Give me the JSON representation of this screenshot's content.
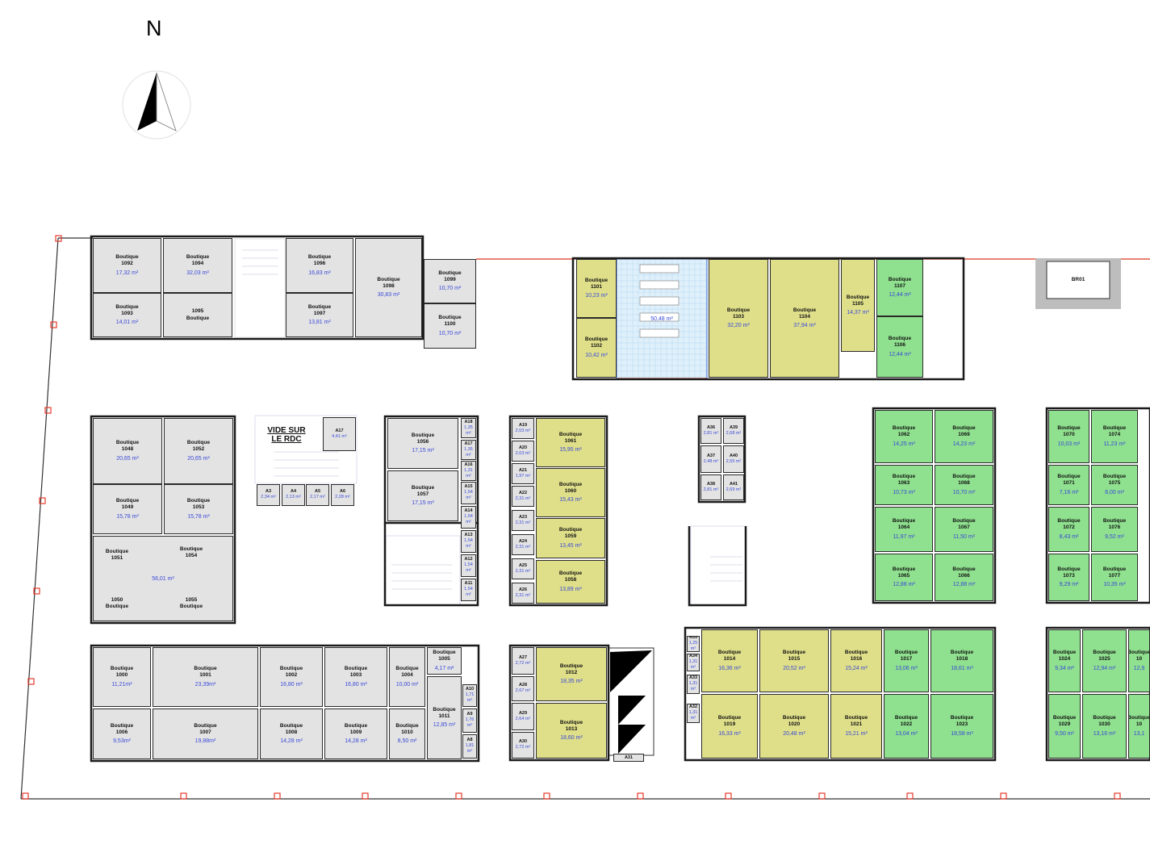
{
  "compass": {
    "label": "N",
    "icon": "north-arrow-icon"
  },
  "colors": {
    "neutral": "#e3e3e3",
    "yellow": "#dfdf8a",
    "green": "#8fe08f",
    "area_text": "#3a4ad8",
    "facade_line": "#d9381e",
    "marker": "#e53a2c"
  },
  "void": {
    "label_line1": "VIDE SUR",
    "label_line2": "LE RDC"
  },
  "north_block": {
    "b1092": {
      "name": "Boutique\n1092",
      "area": "17,32 m²"
    },
    "b1094": {
      "name": "Boutique\n1094",
      "area": "32,03 m²"
    },
    "b1093": {
      "name": "Boutique\n1093",
      "area": "14,01 m²"
    },
    "b1095": {
      "name": "1095\nBoutique",
      "area": ""
    },
    "b1096": {
      "name": "Boutique\n1096",
      "area": "16,83 m²"
    },
    "b1097": {
      "name": "Boutique\n1097",
      "area": "13,81 m²"
    },
    "b1098": {
      "name": "Boutique\n1098",
      "area": "30,83 m²"
    },
    "b1099": {
      "name": "Boutique\n1099",
      "area": "10,70 m²"
    },
    "b1100": {
      "name": "Boutique\n1100",
      "area": "10,70 m²"
    },
    "b1101": {
      "name": "Boutique\n1101",
      "area": "10,23 m²"
    },
    "b1102": {
      "name": "Boutique\n1102",
      "area": "10,42 m²"
    },
    "sanitary": {
      "name": "",
      "area": "50,48 m²"
    },
    "b1103": {
      "name": "Boutique\n1103",
      "area": "32,20 m²"
    },
    "b1104": {
      "name": "Boutique\n1104",
      "area": "37,94 m²"
    },
    "b1105": {
      "name": "Boutique\n1105",
      "area": "14,37 m²"
    },
    "b1107": {
      "name": "Boutique\n1107",
      "area": "12,44 m²"
    },
    "b1106": {
      "name": "Boutique\n1106",
      "area": "12,44 m²"
    },
    "br01": {
      "name": "BR01",
      "area": ""
    }
  },
  "middle_block": {
    "b1048": {
      "name": "Boutique\n1048",
      "area": "20,65 m²"
    },
    "b1052": {
      "name": "Boutique\n1052",
      "area": "20,65 m²"
    },
    "b1049": {
      "name": "Boutique\n1049",
      "area": "15,78 m²"
    },
    "b1053": {
      "name": "Boutique\n1053",
      "area": "15,78 m²"
    },
    "b1051": {
      "name": "Boutique\n1051"
    },
    "b1054": {
      "name": "Boutique\n1054"
    },
    "b1050": {
      "name": "1050\nBoutique"
    },
    "b1055": {
      "name": "1055\nBoutique"
    },
    "hall_area": "56,01 m²",
    "a17_top": {
      "name": "A17",
      "area": "4,41 m²"
    },
    "a3": {
      "name": "A3",
      "area": "2,34 m²"
    },
    "a4": {
      "name": "A4",
      "area": "2,13 m²"
    },
    "a5": {
      "name": "A5",
      "area": "2,17 m²"
    },
    "a6": {
      "name": "A6",
      "area": "2,28 m²"
    },
    "b1056": {
      "name": "Boutique\n1056",
      "area": "17,15 m²"
    },
    "b1057": {
      "name": "Boutique\n1057",
      "area": "17,15 m²"
    },
    "a18": {
      "name": "A18",
      "area": "1,35 m²"
    },
    "a17": {
      "name": "A17",
      "area": "1,35 m²"
    },
    "a16": {
      "name": "A16",
      "area": "1,31 m²"
    },
    "a15": {
      "name": "A15",
      "area": "1,54 m²"
    },
    "a14": {
      "name": "A14",
      "area": "1,54 m²"
    },
    "a13": {
      "name": "A13",
      "area": "1,54 m²"
    },
    "a12": {
      "name": "A12",
      "area": "1,54 m²"
    },
    "a11": {
      "name": "A11",
      "area": "1,54 m²"
    },
    "a19": {
      "name": "A19",
      "area": "2,03 m²"
    },
    "a20": {
      "name": "A20",
      "area": "2,03 m²"
    },
    "a21": {
      "name": "A21",
      "area": "1,97 m²"
    },
    "a22": {
      "name": "A22",
      "area": "2,31 m²"
    },
    "a23": {
      "name": "A23",
      "area": "2,31 m²"
    },
    "a24": {
      "name": "A24",
      "area": "2,31 m²"
    },
    "a25": {
      "name": "A25",
      "area": "2,31 m²"
    },
    "a26": {
      "name": "A26",
      "area": "2,31 m²"
    },
    "b1061": {
      "name": "Boutique\n1061",
      "area": "15,95 m²"
    },
    "b1060": {
      "name": "Boutique\n1060",
      "area": "15,43 m²"
    },
    "b1059": {
      "name": "Boutique\n1059",
      "area": "13,45 m²"
    },
    "b1058": {
      "name": "Boutique\n1058",
      "area": "13,89 m²"
    },
    "a36": {
      "name": "A36",
      "area": "2,81 m²"
    },
    "a39": {
      "name": "A39",
      "area": "2,68 m²"
    },
    "a37": {
      "name": "A37",
      "area": "2,48 m²"
    },
    "a40": {
      "name": "A40",
      "area": "2,55 m²"
    },
    "a38": {
      "name": "A38",
      "area": "2,81 m²"
    },
    "a41": {
      "name": "A41",
      "area": "2,69 m²"
    },
    "b1062": {
      "name": "Boutique\n1062",
      "area": "14,25 m²"
    },
    "b1069": {
      "name": "Boutique\n1069",
      "area": "14,23 m²"
    },
    "b1063": {
      "name": "Boutique\n1063",
      "area": "10,73 m²"
    },
    "b1068": {
      "name": "Boutique\n1068",
      "area": "10,70 m²"
    },
    "b1064": {
      "name": "Boutique\n1064",
      "area": "11,97 m²"
    },
    "b1067": {
      "name": "Boutique\n1067",
      "area": "11,50 m²"
    },
    "b1065": {
      "name": "Boutique\n1065",
      "area": "12,88 m²"
    },
    "b1066": {
      "name": "Boutique\n1066",
      "area": "12,88 m²"
    },
    "b1070": {
      "name": "Boutique\n1070",
      "area": "10,03 m²"
    },
    "b1074": {
      "name": "Boutique\n1074",
      "area": "11,23 m²"
    },
    "b1071": {
      "name": "Boutique\n1071",
      "area": "7,16 m²"
    },
    "b1075": {
      "name": "Boutique\n1075",
      "area": "8,00 m²"
    },
    "b1072": {
      "name": "Boutique\n1072",
      "area": "8,43 m²"
    },
    "b1076": {
      "name": "Boutique\n1076",
      "area": "9,52 m²"
    },
    "b1073": {
      "name": "Boutique\n1073",
      "area": "9,29 m²"
    },
    "b1077": {
      "name": "Boutique\n1077",
      "area": "10,35 m²"
    }
  },
  "south_block": {
    "b1000": {
      "name": "Boutique\n1000",
      "area": "11,21m²"
    },
    "b1001": {
      "name": "Boutique\n1001",
      "area": "23,39m²"
    },
    "b1002": {
      "name": "Boutique\n1002",
      "area": "16,80 m²"
    },
    "b1003": {
      "name": "Boutique\n1003",
      "area": "16,80 m²"
    },
    "b1004": {
      "name": "Boutique\n1004",
      "area": "10,00 m²"
    },
    "b1005": {
      "name": "Boutique\n1005",
      "area": "4,17 m²"
    },
    "b1011": {
      "name": "Boutique\n1011",
      "area": "12,85 m²"
    },
    "b1006": {
      "name": "Boutique\n1006",
      "area": "9,53m²"
    },
    "b1007": {
      "name": "Boutique\n1007",
      "area": "19,88m²"
    },
    "b1008": {
      "name": "Boutique\n1008",
      "area": "14,28 m²"
    },
    "b1009": {
      "name": "Boutique\n1009",
      "area": "14,28 m²"
    },
    "b1010": {
      "name": "Boutique\n1010",
      "area": "8,50 m²"
    },
    "a10": {
      "name": "A10",
      "area": "1,71 m²"
    },
    "a9": {
      "name": "A9",
      "area": "1,76 m²"
    },
    "a8": {
      "name": "A8",
      "area": "1,81 m²"
    },
    "a27": {
      "name": "A27",
      "area": "2,72 m²"
    },
    "a28": {
      "name": "A28",
      "area": "2,67 m²"
    },
    "a29": {
      "name": "A29",
      "area": "2,64 m²"
    },
    "a30": {
      "name": "A30",
      "area": "2,72 m²"
    },
    "b1012": {
      "name": "Boutique\n1012",
      "area": "18,35 m²"
    },
    "b1013": {
      "name": "Boutique\n1013",
      "area": "18,60 m²"
    },
    "a31": {
      "name": "A31",
      "area": ""
    },
    "a35": {
      "name": "A35",
      "area": "1,25 m²"
    },
    "a34": {
      "name": "A34",
      "area": "1,31 m²"
    },
    "a33": {
      "name": "A33",
      "area": "1,31 m²"
    },
    "a32": {
      "name": "A32",
      "area": "1,31 m²"
    },
    "b1014": {
      "name": "Boutique\n1014",
      "area": "16,36 m²"
    },
    "b1015": {
      "name": "Boutique\n1015",
      "area": "20,52 m²"
    },
    "b1016": {
      "name": "Boutique\n1016",
      "area": "15,24 m²"
    },
    "b1017": {
      "name": "Boutique\n1017",
      "area": "13,06 m²"
    },
    "b1018": {
      "name": "Boutique\n1018",
      "area": "18,61 m²"
    },
    "b1019": {
      "name": "Boutique\n1019",
      "area": "16,33 m²"
    },
    "b1020": {
      "name": "Boutique\n1020",
      "area": "20,48 m²"
    },
    "b1021": {
      "name": "Boutique\n1021",
      "area": "15,21 m²"
    },
    "b1022": {
      "name": "Boutique\n1022",
      "area": "13,04 m²"
    },
    "b1023": {
      "name": "Boutique\n1023",
      "area": "18,58 m²"
    },
    "b1024": {
      "name": "Boutique\n1024",
      "area": "9,34 m²"
    },
    "b1025": {
      "name": "Boutique\n1025",
      "area": "12,94 m²"
    },
    "b1026": {
      "name": "Boutique\n10",
      "area": "12,9"
    },
    "b1029": {
      "name": "Boutique\n1029",
      "area": "9,50 m²"
    },
    "b1030": {
      "name": "Boutique\n1030",
      "area": "13,16 m²"
    },
    "b1031": {
      "name": "Boutique\n10",
      "area": "13,1"
    }
  }
}
